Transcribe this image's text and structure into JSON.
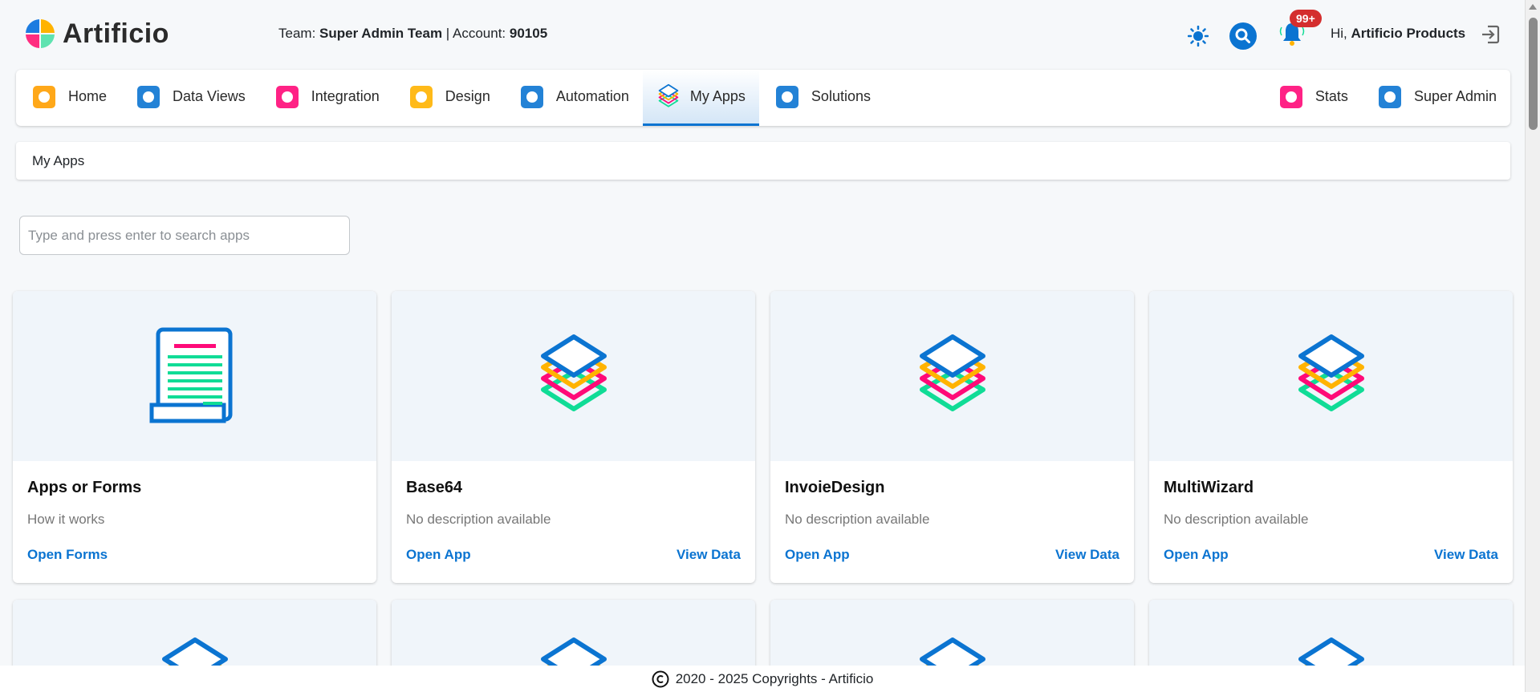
{
  "header": {
    "brand": "Artificio",
    "team_label": "Team:",
    "team": "Super Admin Team",
    "account_label": "| Account:",
    "account": "90105",
    "notifications": "99+",
    "greeting": "Hi,",
    "user": "Artificio Products"
  },
  "nav": {
    "items": [
      {
        "label": "Home"
      },
      {
        "label": "Data Views"
      },
      {
        "label": "Integration"
      },
      {
        "label": "Design"
      },
      {
        "label": "Automation"
      },
      {
        "label": "My Apps",
        "active": true
      },
      {
        "label": "Solutions"
      }
    ],
    "right": [
      {
        "label": "Stats"
      },
      {
        "label": "Super Admin"
      }
    ]
  },
  "breadcrumb": "My Apps",
  "search": {
    "placeholder": "Type and press enter to search apps",
    "value": ""
  },
  "cards": [
    {
      "title": "Apps or Forms",
      "desc": "How it works",
      "primary": "Open Forms",
      "secondary": "",
      "icon": "scroll-icon"
    },
    {
      "title": "Base64",
      "desc": "No description available",
      "primary": "Open App",
      "secondary": "View Data",
      "icon": "layers-icon"
    },
    {
      "title": "InvoieDesign",
      "desc": "No description available",
      "primary": "Open App",
      "secondary": "View Data",
      "icon": "layers-icon"
    },
    {
      "title": "MultiWizard",
      "desc": "No description available",
      "primary": "Open App",
      "secondary": "View Data",
      "icon": "layers-icon"
    }
  ],
  "footer": "2020 - 2025 Copyrights - Artificio",
  "colors": {
    "accent": "#0b74d1",
    "badge": "#d42e2e",
    "yellow": "#ffb300",
    "pink": "#ff0a78",
    "green": "#10dc96"
  }
}
